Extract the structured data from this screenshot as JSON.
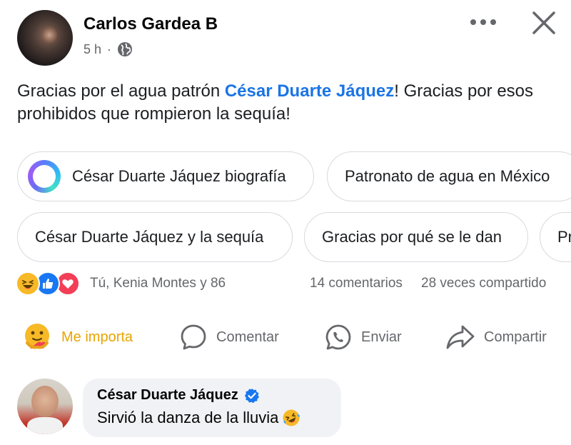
{
  "post": {
    "author": "Carlos Gardea B",
    "time": "5 h",
    "separator": "·",
    "privacy_icon": "globe-icon",
    "text_before": "Gracias por el agua patrón ",
    "mention": "César Duarte Jáquez",
    "text_after": "! Gracias por esos prohibidos que rompieron la sequía!"
  },
  "suggestions": [
    {
      "label": "César Duarte Jáquez biografía",
      "icon": "meta-ai-ring-icon"
    },
    {
      "label": "Patronato de agua en México"
    },
    {
      "label": "César Duarte Jáquez y la sequía"
    },
    {
      "label": "Gracias por qué se le dan"
    },
    {
      "label": "Pr"
    }
  ],
  "stats": {
    "reaction_icons": [
      "haha-icon",
      "like-icon",
      "love-icon"
    ],
    "reaction_names": "Tú, Kenia Montes y 86",
    "comments": "14 comentarios",
    "shares": "28 veces compartido"
  },
  "actions": {
    "care_label": "Me importa",
    "comment_label": "Comentar",
    "send_label": "Enviar",
    "share_label": "Compartir"
  },
  "comment": {
    "author": "César Duarte Jáquez",
    "verified_icon": "verified-badge-icon",
    "text": "Sirvió la danza de la lluvia",
    "emoji_icon": "rolling-laughing-emoji-icon"
  },
  "colors": {
    "mention": "#1b74e4",
    "care_active": "#e9a400",
    "meta_text": "#65676b",
    "bubble_bg": "#f0f2f5"
  }
}
